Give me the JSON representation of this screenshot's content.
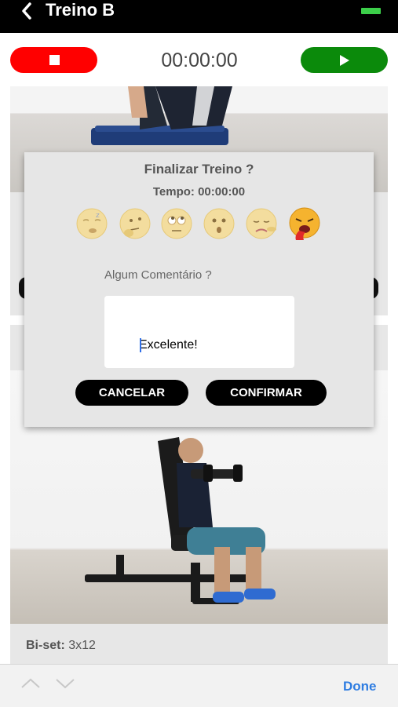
{
  "header": {
    "title": "Treino B"
  },
  "controls": {
    "timer": "00:00:00"
  },
  "modal": {
    "title": "Finalizar Treino ?",
    "time_label": "Tempo: 00:00:00",
    "emojis": [
      "sleepy-face",
      "thinking-face",
      "rolling-eyes-face",
      "surprised-face",
      "sad-pointing-face",
      "vomiting-face"
    ],
    "comment_label": "Algum Comentário ?",
    "comment_value": "Excelente!",
    "cancel_label": "CANCELAR",
    "confirm_label": "CONFIRMAR"
  },
  "exercise": {
    "label": "Bi-set:",
    "value": " 3x12"
  },
  "keyboard_toolbar": {
    "done_label": "Done"
  }
}
